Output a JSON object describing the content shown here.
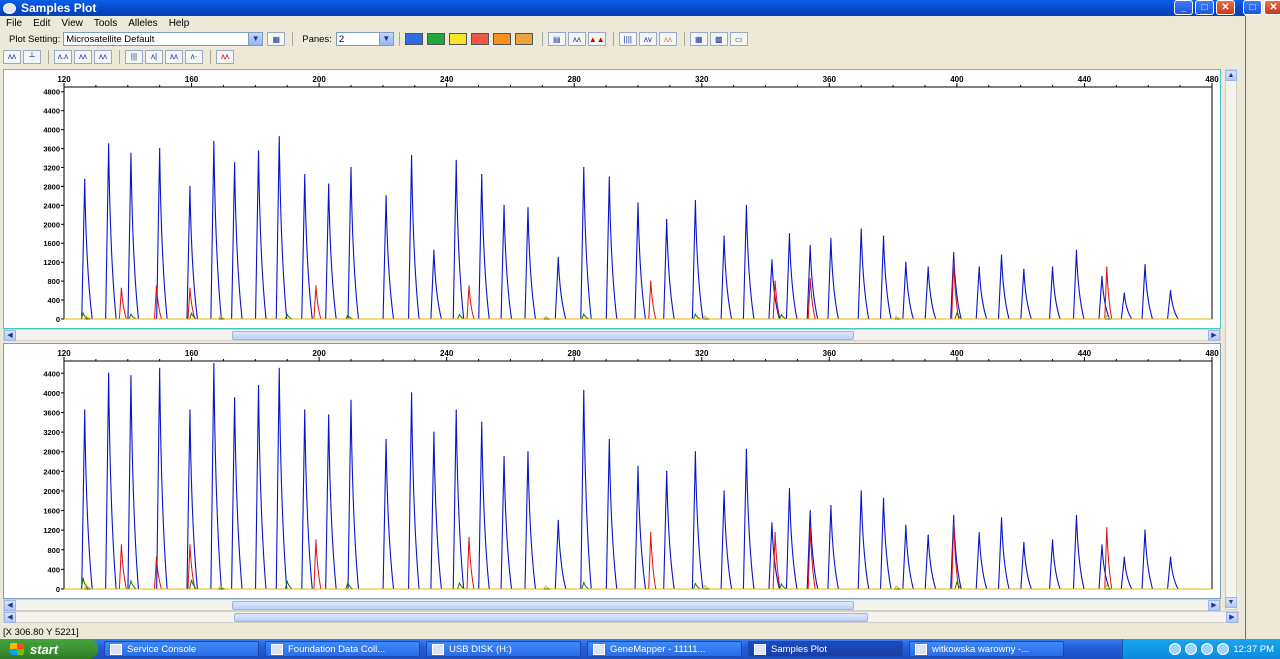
{
  "window": {
    "title": "Samples Plot"
  },
  "menu": [
    "File",
    "Edit",
    "View",
    "Tools",
    "Alleles",
    "Help"
  ],
  "toolbar": {
    "plot_setting_label": "Plot Setting:",
    "plot_setting_value": "Microsatellite Default",
    "panes_label": "Panes:",
    "panes_value": "2",
    "dye_colors": [
      "#2e6ce6",
      "#21a83c",
      "#f6e427",
      "#f0574a",
      "#f6901e",
      "#e9a53a"
    ]
  },
  "chart_data": [
    {
      "type": "line",
      "title": "",
      "xlabel": "",
      "ylabel": "",
      "x_ticks": [
        120,
        160,
        200,
        240,
        280,
        320,
        360,
        400,
        440,
        480
      ],
      "y_ticks": [
        0,
        400,
        800,
        1200,
        1600,
        2000,
        2400,
        2800,
        3200,
        3600,
        4000,
        4400,
        4800
      ],
      "xlim": [
        120,
        480
      ],
      "ylim": [
        0,
        4900
      ],
      "series": [
        {
          "color": "#0b12c8",
          "peaks": [
            [
              126.5,
              2950
            ],
            [
              134,
              3700
            ],
            [
              141,
              3500
            ],
            [
              150,
              3600
            ],
            [
              159.5,
              2800
            ],
            [
              167,
              3750
            ],
            [
              173.5,
              3300
            ],
            [
              181,
              3550
            ],
            [
              187.5,
              3850
            ],
            [
              195.5,
              3050
            ],
            [
              203,
              2850
            ],
            [
              210,
              3200
            ],
            [
              221,
              2600
            ],
            [
              229,
              3450
            ],
            [
              236,
              1450
            ],
            [
              243,
              3350
            ],
            [
              251,
              3050
            ],
            [
              258,
              2400
            ],
            [
              265.5,
              2350
            ],
            [
              275,
              1300
            ],
            [
              283,
              3200
            ],
            [
              291,
              3000
            ],
            [
              300,
              2450
            ],
            [
              309,
              2100
            ],
            [
              318,
              2500
            ],
            [
              327,
              1750
            ],
            [
              334,
              2400
            ],
            [
              342,
              1250
            ],
            [
              347.5,
              1800
            ],
            [
              354,
              1550
            ],
            [
              360.5,
              1700
            ],
            [
              370,
              1900
            ],
            [
              377,
              1750
            ],
            [
              384,
              1200
            ],
            [
              391,
              1100
            ],
            [
              399,
              1400
            ],
            [
              407,
              1100
            ],
            [
              414,
              1350
            ],
            [
              421,
              1050
            ],
            [
              430,
              1100
            ],
            [
              437.5,
              1450
            ],
            [
              445.5,
              900
            ],
            [
              452.5,
              550
            ],
            [
              459,
              1150
            ],
            [
              467,
              600
            ]
          ]
        },
        {
          "color": "#d81010",
          "peaks": [
            [
              138,
              650
            ],
            [
              149,
              700
            ],
            [
              159.5,
              650
            ],
            [
              199,
              700
            ],
            [
              247,
              700
            ],
            [
              304,
              800
            ],
            [
              343,
              800
            ],
            [
              354,
              850
            ],
            [
              399,
              1200
            ],
            [
              447,
              1100
            ]
          ]
        },
        {
          "color": "#107a10",
          "peaks": [
            [
              126,
              120
            ],
            [
              141,
              100
            ],
            [
              160,
              120
            ],
            [
              190,
              90
            ],
            [
              209,
              80
            ],
            [
              244,
              90
            ],
            [
              283,
              100
            ],
            [
              318,
              100
            ],
            [
              345,
              90
            ],
            [
              400,
              120
            ]
          ]
        },
        {
          "color": "#f0b000",
          "peaks": [
            [
              127,
              60
            ],
            [
              169,
              60
            ],
            [
              271,
              50
            ],
            [
              321,
              60
            ],
            [
              381,
              50
            ],
            [
              447,
              70
            ]
          ]
        }
      ]
    },
    {
      "type": "line",
      "title": "",
      "xlabel": "",
      "ylabel": "",
      "x_ticks": [
        120,
        160,
        200,
        240,
        280,
        320,
        360,
        400,
        440,
        480
      ],
      "y_ticks": [
        0,
        400,
        800,
        1200,
        1600,
        2000,
        2400,
        2800,
        3200,
        3600,
        4000,
        4400
      ],
      "xlim": [
        120,
        480
      ],
      "ylim": [
        0,
        4650
      ],
      "series": [
        {
          "color": "#0b12c8",
          "peaks": [
            [
              126.5,
              3650
            ],
            [
              134,
              4400
            ],
            [
              141,
              4350
            ],
            [
              150,
              4500
            ],
            [
              159.5,
              3650
            ],
            [
              167,
              4600
            ],
            [
              173.5,
              3900
            ],
            [
              181,
              4150
            ],
            [
              187.5,
              4500
            ],
            [
              195.5,
              3650
            ],
            [
              203,
              3550
            ],
            [
              210,
              3850
            ],
            [
              221,
              3050
            ],
            [
              229,
              4000
            ],
            [
              236,
              3200
            ],
            [
              243,
              3650
            ],
            [
              251,
              3400
            ],
            [
              258,
              2700
            ],
            [
              265.5,
              2800
            ],
            [
              275,
              1400
            ],
            [
              283,
              4050
            ],
            [
              291,
              3050
            ],
            [
              300,
              2500
            ],
            [
              309,
              2400
            ],
            [
              318,
              2800
            ],
            [
              327,
              2000
            ],
            [
              334,
              2850
            ],
            [
              342,
              1350
            ],
            [
              347.5,
              2050
            ],
            [
              354,
              1600
            ],
            [
              360.5,
              1700
            ],
            [
              370,
              2000
            ],
            [
              377,
              1850
            ],
            [
              384,
              1300
            ],
            [
              391,
              1100
            ],
            [
              399,
              1500
            ],
            [
              407,
              1150
            ],
            [
              414,
              1450
            ],
            [
              421,
              950
            ],
            [
              430,
              1000
            ],
            [
              437.5,
              1500
            ],
            [
              445.5,
              900
            ],
            [
              452.5,
              650
            ],
            [
              459,
              1200
            ],
            [
              467,
              650
            ]
          ]
        },
        {
          "color": "#d81010",
          "peaks": [
            [
              138,
              900
            ],
            [
              149,
              650
            ],
            [
              159.5,
              900
            ],
            [
              199,
              1000
            ],
            [
              247,
              1050
            ],
            [
              304,
              1150
            ],
            [
              343,
              1150
            ],
            [
              354,
              1250
            ],
            [
              399,
              1350
            ],
            [
              447,
              1250
            ]
          ]
        },
        {
          "color": "#107a10",
          "peaks": [
            [
              126,
              220
            ],
            [
              141,
              160
            ],
            [
              160,
              180
            ],
            [
              190,
              150
            ],
            [
              209,
              120
            ],
            [
              244,
              120
            ],
            [
              283,
              130
            ],
            [
              318,
              110
            ],
            [
              345,
              100
            ],
            [
              400,
              140
            ]
          ]
        },
        {
          "color": "#f0b000",
          "peaks": [
            [
              127,
              90
            ],
            [
              169,
              70
            ],
            [
              271,
              60
            ],
            [
              321,
              70
            ],
            [
              381,
              60
            ],
            [
              447,
              80
            ]
          ]
        }
      ]
    }
  ],
  "status": {
    "coords": "[X 306.80  Y 5221]"
  },
  "taskbar": {
    "start": "start",
    "tasks": [
      "Service Console",
      "Foundation Data Coll...",
      "USB DISK (H:)",
      "GeneMapper - 11111...",
      "Samples Plot",
      "witkowska warowny -..."
    ],
    "clock": "12:37 PM"
  }
}
